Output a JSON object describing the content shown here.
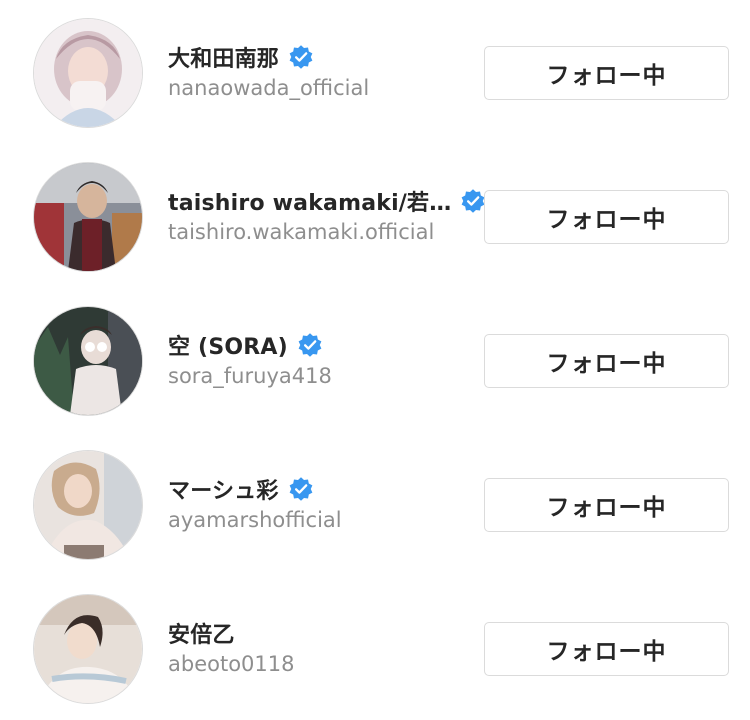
{
  "following_list": [
    {
      "display_name": "大和田南那",
      "username": "nanaowada_official",
      "verified": true,
      "button_label": "フォロー中"
    },
    {
      "display_name": "taishiro wakamaki/若…",
      "username": "taishiro.wakamaki.official",
      "verified": true,
      "button_label": "フォロー中"
    },
    {
      "display_name": "空 (SORA)",
      "username": "sora_furuya418",
      "verified": true,
      "button_label": "フォロー中"
    },
    {
      "display_name": "マーシュ彩",
      "username": "ayamarshofficial",
      "verified": true,
      "button_label": "フォロー中"
    },
    {
      "display_name": "安倍乙",
      "username": "abeoto0118",
      "verified": false,
      "button_label": "フォロー中"
    }
  ],
  "colors": {
    "verified_blue": "#3897f0",
    "name_text": "#262626",
    "handle_text": "#8e8e8e",
    "button_border": "#dbdbdb"
  },
  "icons": {
    "verified": "verified-badge-icon"
  }
}
